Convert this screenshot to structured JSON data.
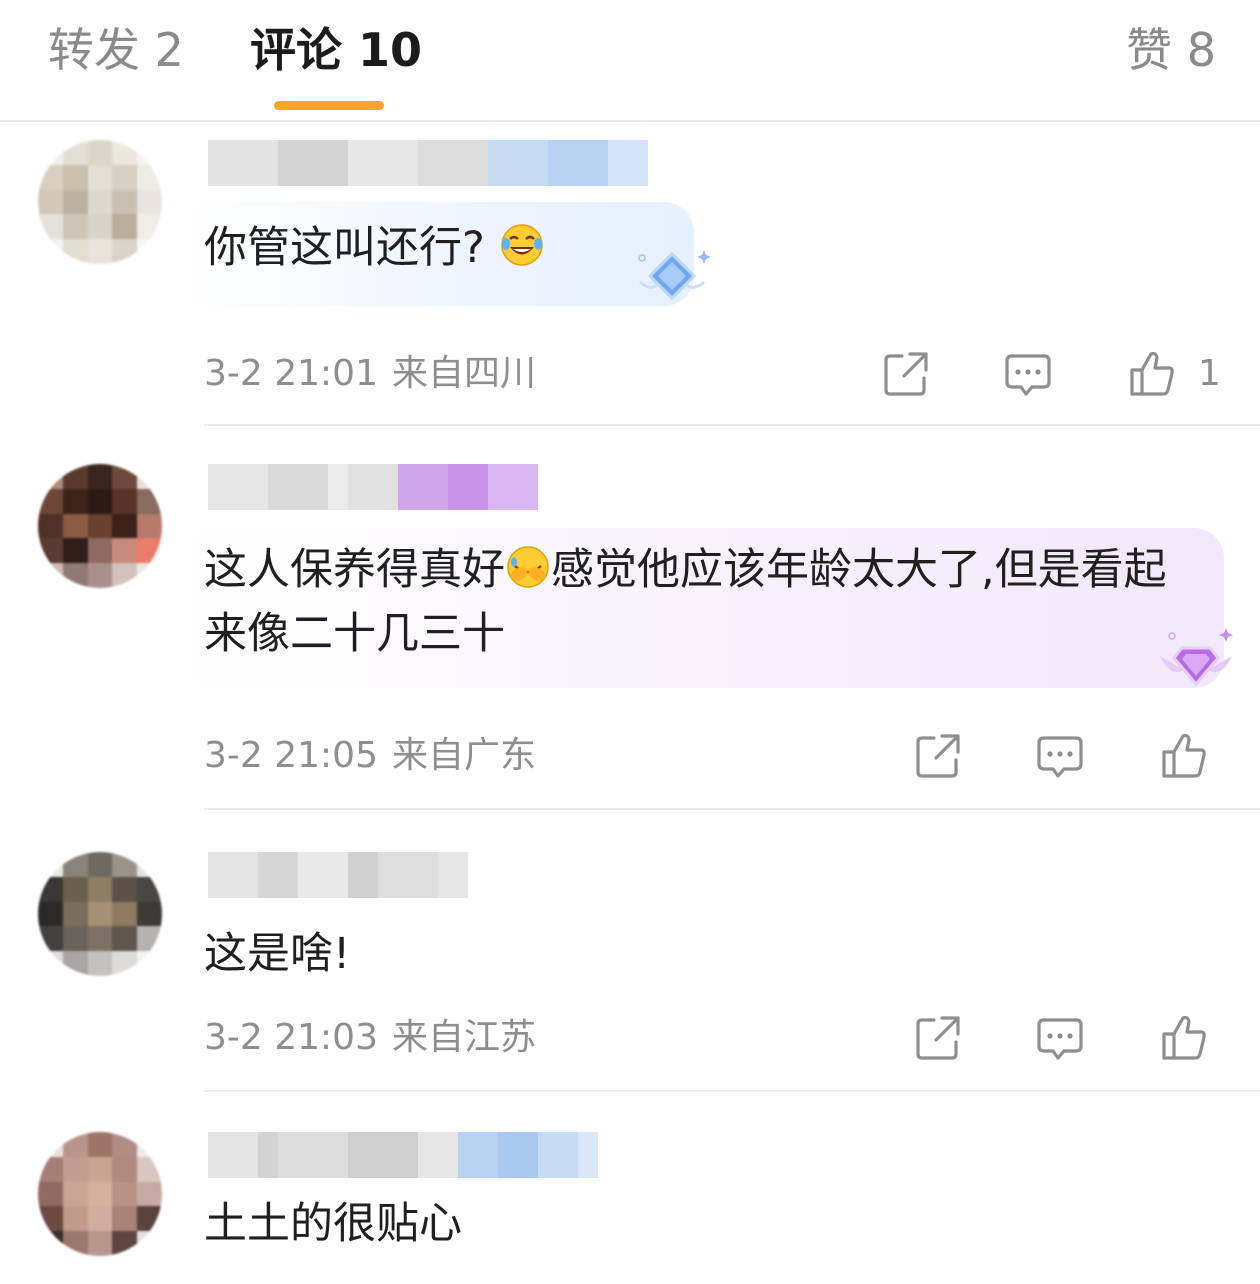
{
  "colors": {
    "accent": "#f5a623",
    "tab_active": "#1c1c1c",
    "tab_inactive": "#8a8a8a",
    "meta_text": "#8e8e8e",
    "bubble_blue": "#eaf3ff",
    "bubble_purple": "#f3ecfb"
  },
  "tabs": {
    "repost": "转发 2",
    "comment": "评论 10",
    "like": "赞 8"
  },
  "comments": [
    {
      "text": "你管这叫还行?",
      "emoji": "laughing-tears-emoji",
      "time": "3-2 21:01",
      "location": "来自四川",
      "like_count": "1",
      "badge": "blue-diamond-badge"
    },
    {
      "text_before_emoji": "这人保养得真好",
      "emoji": "covering-face-emoji",
      "text_after_emoji": "感觉他应该年龄太大了,但是看起来像二十几三十",
      "time": "3-2 21:05",
      "location": "来自广东",
      "like_count": "",
      "badge": "purple-diamond-badge"
    },
    {
      "text": "这是啥!",
      "time": "3-2 21:03",
      "location": "来自江苏",
      "like_count": ""
    },
    {
      "text": "土土的很贴心"
    }
  ],
  "icons": {
    "share": "share-icon",
    "reply": "comment-icon",
    "like": "thumbs-up-icon"
  }
}
